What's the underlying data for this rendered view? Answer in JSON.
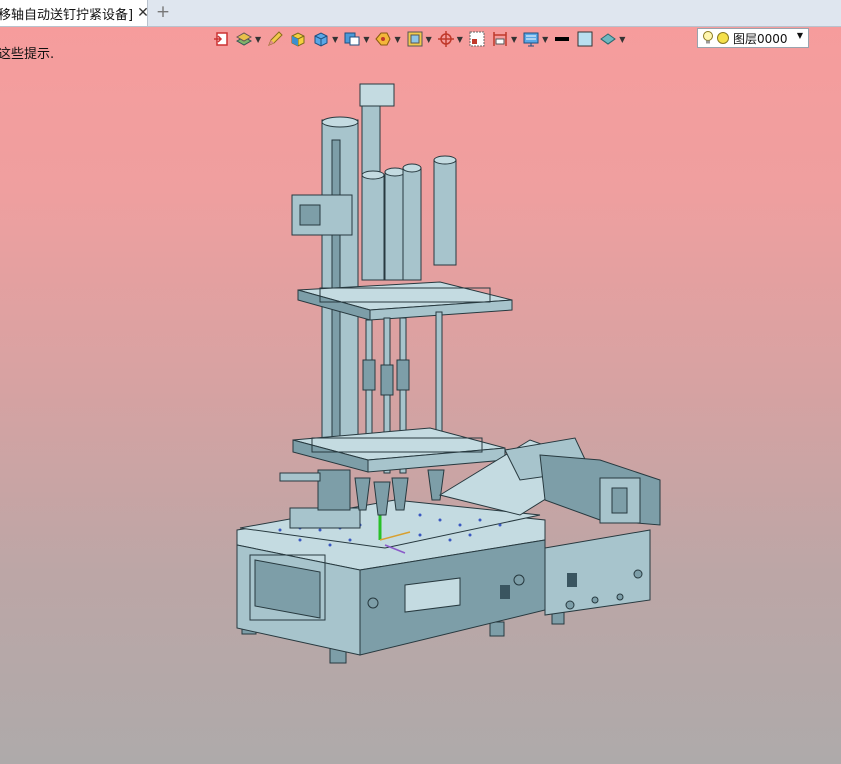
{
  "tabs": [
    {
      "label": "移轴自动送钉拧紧设备]",
      "close_icon": "close-icon"
    }
  ],
  "add_tab_icon": "plus-icon",
  "hint_text": "这些提示.",
  "toolbar": {
    "buttons": [
      {
        "icon": "render-mode-icon",
        "has_dropdown": false
      },
      {
        "icon": "layers-icon",
        "has_dropdown": true
      },
      {
        "icon": "pencil-icon",
        "has_dropdown": false
      },
      {
        "icon": "cube-yellow-icon",
        "has_dropdown": false
      },
      {
        "icon": "cube-blue-icon",
        "has_dropdown": true
      },
      {
        "icon": "views-icon",
        "has_dropdown": true
      },
      {
        "icon": "section-icon",
        "has_dropdown": true
      },
      {
        "icon": "frame-icon",
        "has_dropdown": true
      },
      {
        "icon": "axis-icon",
        "has_dropdown": true
      },
      {
        "icon": "box-select-icon",
        "has_dropdown": false
      },
      {
        "icon": "dimension-icon",
        "has_dropdown": true
      },
      {
        "icon": "display-icon",
        "has_dropdown": true
      },
      {
        "icon": "line-style-icon",
        "has_dropdown": false
      },
      {
        "icon": "color-swatch-icon",
        "has_dropdown": false
      },
      {
        "icon": "material-icon",
        "has_dropdown": true
      }
    ]
  },
  "layer_selector": {
    "value": "图层0000",
    "icons": [
      "bulb-icon",
      "sun-icon"
    ]
  },
  "colors": {
    "background_top": "#f79c9c",
    "background_bottom": "#aeaaaa",
    "model_fill": "#a7c4cc",
    "model_stroke": "#27393f"
  }
}
